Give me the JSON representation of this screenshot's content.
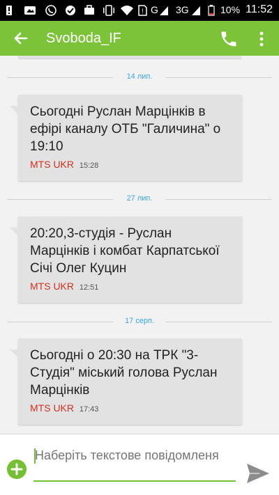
{
  "status_bar": {
    "signal_label": "G",
    "network_label": "3G",
    "battery_label": "10%",
    "time": "11:52",
    "icons": [
      "alert-icon",
      "whatsapp-icon",
      "check-circle-icon",
      "briefcase-icon",
      "vibrate-icon",
      "wifi-icon",
      "sim-alert-icon",
      "signal-icon",
      "signal-2-icon",
      "battery-icon"
    ]
  },
  "app_bar": {
    "title": "Svoboda_IF",
    "accent_color": "#7dc33a"
  },
  "thread": {
    "date_separators": [
      "14 лип.",
      "27 лип.",
      "17 серп."
    ],
    "messages": [
      {
        "text": "Сьогодні Руслан Марцінків в ефірі каналу ОТБ \"Галичина\" о 19:10",
        "sender": "MTS UKR",
        "time": "15:28"
      },
      {
        "text": "20:20,3-студія - Руслан Марцінків і комбат Карпатської Січі Олег Куцин",
        "sender": "MTS UKR",
        "time": "12:51"
      },
      {
        "text": "Сьогодні о 20:30 на ТРК \"3-Студія\" міський голова Руслан Марцінків",
        "sender": "MTS UKR",
        "time": "17:43"
      }
    ]
  },
  "composer": {
    "placeholder": "Наберіть текстове повідомленя"
  }
}
